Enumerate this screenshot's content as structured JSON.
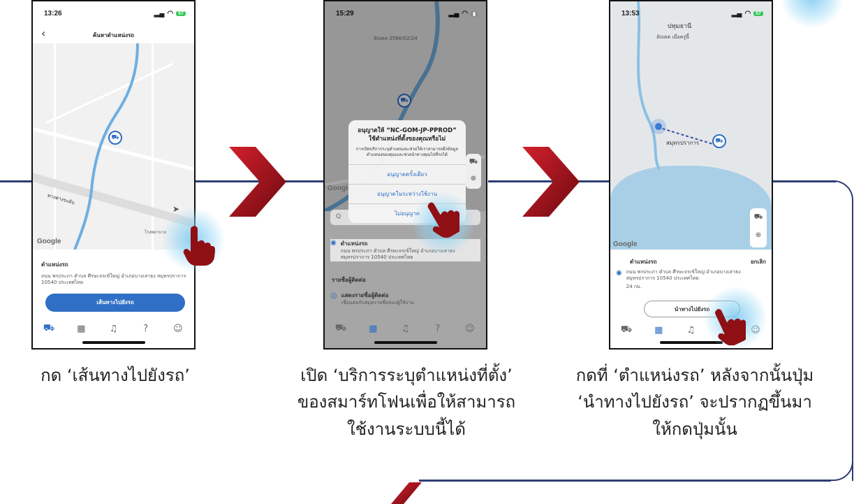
{
  "steps": [
    {
      "caption_lines": [
        "กด ‘เส้นทางไปยังรถ’"
      ],
      "phone": {
        "time": "13:26",
        "battery": "57",
        "header_title": "ค้นหาตำแหน่งรถ",
        "map_label": "ทางต่างระดับ",
        "map_label_2": "โรงพยาบาล",
        "google": "Google",
        "card_title": "ตำแหน่งรถ",
        "card_address": "ถนน พรประภา ตำบล ศีรษะจรเข้ใหญ่ อำเภอบางเสาธง สมุทรปราการ 10540 ประเทศไทย",
        "route_button": "เส้นทางไปยังรถ"
      }
    },
    {
      "caption_lines": [
        "เปิด ‘บริการระบุตำแหน่งที่ตั้ง’",
        "ของสมาร์ทโฟนเพื่อให้สามารถ",
        "ใช้งานระบบนี้ได้"
      ],
      "phone": {
        "time": "15:29",
        "date_label": "อัปเดต 2566/02/24",
        "google": "Google",
        "dialog_title": "อนุญาตให้ “NC-GOM-JP-PPROD” ใช้ตำแหน่งที่ตั้งของคุณหรือไม่",
        "dialog_message": "การเปิดบริการระบุตำแหน่งจะช่วยให้เราสามารถดึงข้อมูลตำแหน่งของคุณและช่วยนำทางคุณไปที่รถได้",
        "allow_once": "อนุญาตครั้งเดียว",
        "allow_while_using": "อนุญาตในระหว่างใช้งาน",
        "dont_allow": "ไม่อนุญาต",
        "search_placeholder": "Q",
        "card_title": "ตำแหน่งรถ",
        "card_address": "ถนน พรประภา ตำบล ศีรษะจรเข้ใหญ่ อำเภอบางเสาธง สมุทรปราการ 10540 ประเทศไทย",
        "contacts_header": "รายชื่อผู้ติดต่อ",
        "contacts_title": "แสดงรายชื่อผู้ติดต่อ",
        "contacts_sub": "เชื่อมต่อกับสมุดรายชื่อของผู้ใช้งาน"
      }
    },
    {
      "caption_lines": [
        "กดที่ ‘ตำแหน่งรถ’ หลังจากนั้นปุ่ม",
        "‘นำทางไปยังรถ’ จะปรากฏขึ้นมา",
        "ให้กดปุ่มนั้น"
      ],
      "phone": {
        "time": "13:53",
        "battery": "57",
        "date_label": "อัปเดต เมื่อครู่นี้",
        "city_1": "ปทุมธานี",
        "city_2": "สมุทรปราการ",
        "google": "Google",
        "card_title": "ตำแหน่งรถ",
        "cancel": "ยกเลิก",
        "card_address": "ถนน พรประภา ตำบล ศีรษะจรเข้ใหญ่ อำเภอบางเสาธง สมุทรปราการ 10540 ประเทศไทย",
        "distance": "24 กม.",
        "navigate_button": "นำทางไปยังรถ"
      }
    }
  ],
  "colors": {
    "line": "#2f3d73",
    "chevron": "#a3131d",
    "primary": "#2f6fc5",
    "hand": "#8e0f14"
  },
  "icons": [
    "car-icon",
    "map-icon",
    "bell-icon",
    "help-icon",
    "person-icon",
    "back-arrow-icon",
    "locate-icon",
    "chevron-right-icon",
    "hand-pointer-icon"
  ]
}
